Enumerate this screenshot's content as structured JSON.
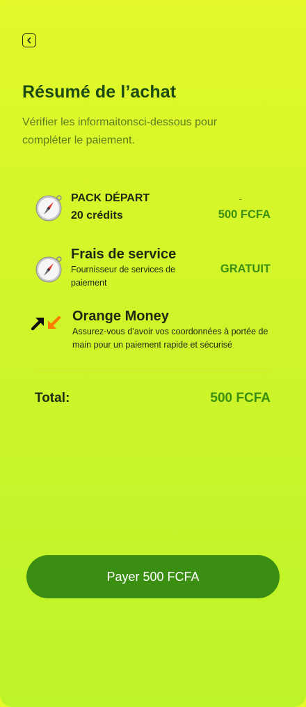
{
  "header": {
    "back_icon": "chevron-left-icon",
    "title": "Résumé de l’achat",
    "subtitle": "Vérifier les informaitonsci-dessous pour compléter le paiement."
  },
  "summary": {
    "pack": {
      "icon": "compass-icon",
      "name": "PACK DÉPART",
      "credits": "20 crédits",
      "dash": "-",
      "price": "500 FCFA"
    },
    "service": {
      "icon": "compass-icon",
      "name": "Frais de service",
      "description": "Fournisseur de services de paiement",
      "price": "GRATUIT"
    },
    "payment_method": {
      "icon": "orange-money-logo-icon",
      "name": "Orange Money",
      "description": "Assurez-vous d’avoir vos coordonnées à portée de main pour un paiement rapide et sécurisé"
    }
  },
  "total": {
    "label": "Total:",
    "value": "500 FCFA"
  },
  "pay_button": {
    "label": "Payer 500 FCFA"
  },
  "colors": {
    "accent": "#3a8f12",
    "title": "#1c4a12",
    "background_top": "#e3f92b",
    "background_bottom": "#bdf329"
  }
}
